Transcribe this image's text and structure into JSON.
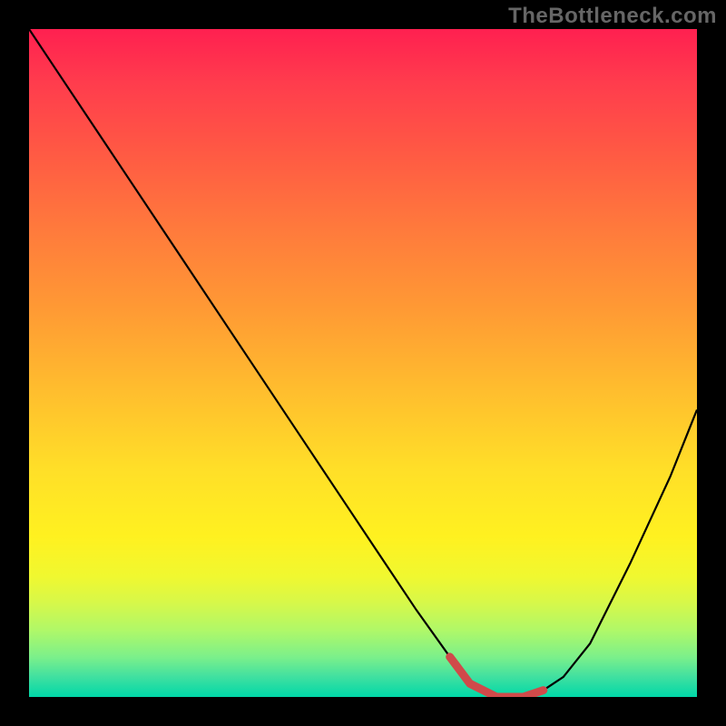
{
  "watermark": "TheBottleneck.com",
  "colors": {
    "background": "#000000",
    "curve_stroke": "#000000",
    "highlight_stroke": "#d04a4a",
    "gradient_stops": [
      "#ff2050",
      "#ff3c4d",
      "#ff5844",
      "#ff7a3c",
      "#ff9a34",
      "#ffbd2e",
      "#ffdf28",
      "#fff120",
      "#f0f830",
      "#d6f84a",
      "#b0f868",
      "#7cf08a",
      "#40e0a0",
      "#00d8a8"
    ]
  },
  "chart_data": {
    "type": "line",
    "title": "",
    "xlabel": "",
    "ylabel": "",
    "xlim": [
      0,
      100
    ],
    "ylim": [
      0,
      100
    ],
    "grid": false,
    "legend": false,
    "series": [
      {
        "name": "bottleneck-curve",
        "x": [
          0,
          4,
          12,
          22,
          32,
          42,
          52,
          58,
          63,
          66,
          70,
          74,
          77,
          80,
          84,
          90,
          96,
          100
        ],
        "y": [
          100,
          94,
          82,
          67,
          52,
          37,
          22,
          13,
          6,
          2,
          0,
          0,
          1,
          3,
          8,
          20,
          33,
          43
        ]
      }
    ],
    "highlight_range": {
      "name": "optimal-range",
      "x": [
        63,
        66,
        70,
        74,
        77
      ],
      "y": [
        6,
        2,
        0,
        0,
        1
      ]
    }
  }
}
